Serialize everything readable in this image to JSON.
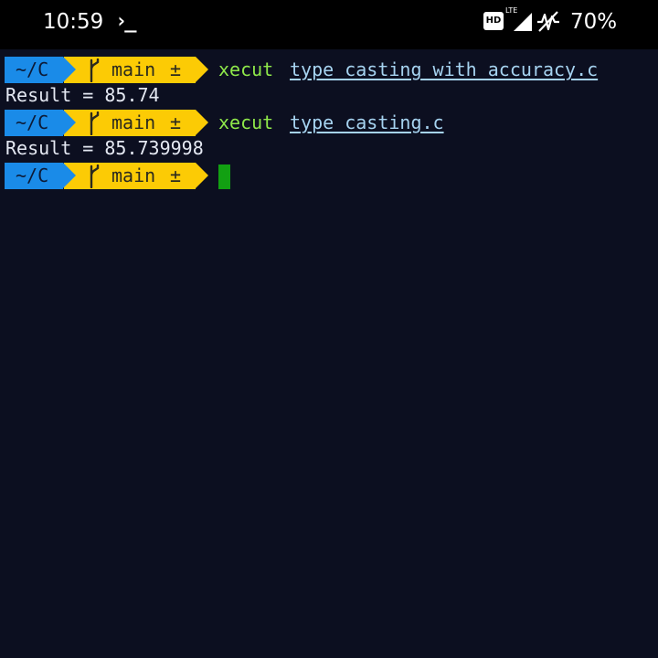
{
  "status_bar": {
    "time": "10:59",
    "terminal_glyph": "›_",
    "hd_badge": "HD",
    "network_label": "LTE",
    "battery": "70%",
    "icons": [
      "terminal-icon",
      "hd-icon",
      "cellular-signal-icon",
      "wifi-off-icon"
    ]
  },
  "terminal": {
    "colors": {
      "background": "#0c0f20",
      "dir_segment": "#1a8be8",
      "git_segment": "#fccb05",
      "command": "#8fe84a",
      "argument": "#a6d3f0",
      "output": "#e4e8f2",
      "cursor": "#12a012"
    },
    "prompts": [
      {
        "dir": "~/C",
        "branch": "main",
        "dirty": "±",
        "command": "xecut",
        "argument": "type_casting_with_accuracy.c",
        "output": "Result = 85.74"
      },
      {
        "dir": "~/C",
        "branch": "main",
        "dirty": "±",
        "command": "xecut",
        "argument": "type_casting.c",
        "output": "Result = 85.739998"
      },
      {
        "dir": "~/C",
        "branch": "main",
        "dirty": "±",
        "command": "",
        "argument": "",
        "output": null
      }
    ]
  }
}
